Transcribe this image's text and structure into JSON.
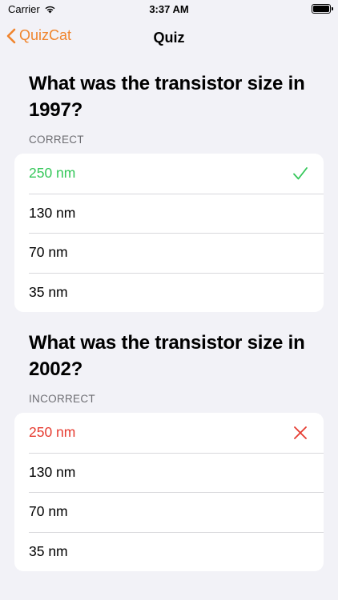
{
  "status_bar": {
    "carrier": "Carrier",
    "time": "3:37 AM"
  },
  "nav": {
    "back_label": "QuizCat",
    "title": "Quiz"
  },
  "questions": [
    {
      "title": "What was the transistor size in 1997?",
      "result_label": "CORRECT",
      "options": [
        "250 nm",
        "130 nm",
        "70 nm",
        "35 nm"
      ],
      "selected_index": 0,
      "selected_state": "correct"
    },
    {
      "title": "What was the transistor size in 2002?",
      "result_label": "INCORRECT",
      "options": [
        "250 nm",
        "130 nm",
        "70 nm",
        "35 nm"
      ],
      "selected_index": 0,
      "selected_state": "incorrect"
    }
  ],
  "colors": {
    "accent": "#f0852d",
    "correct": "#34c759",
    "incorrect": "#e63b30",
    "background": "#f2f2f7"
  }
}
